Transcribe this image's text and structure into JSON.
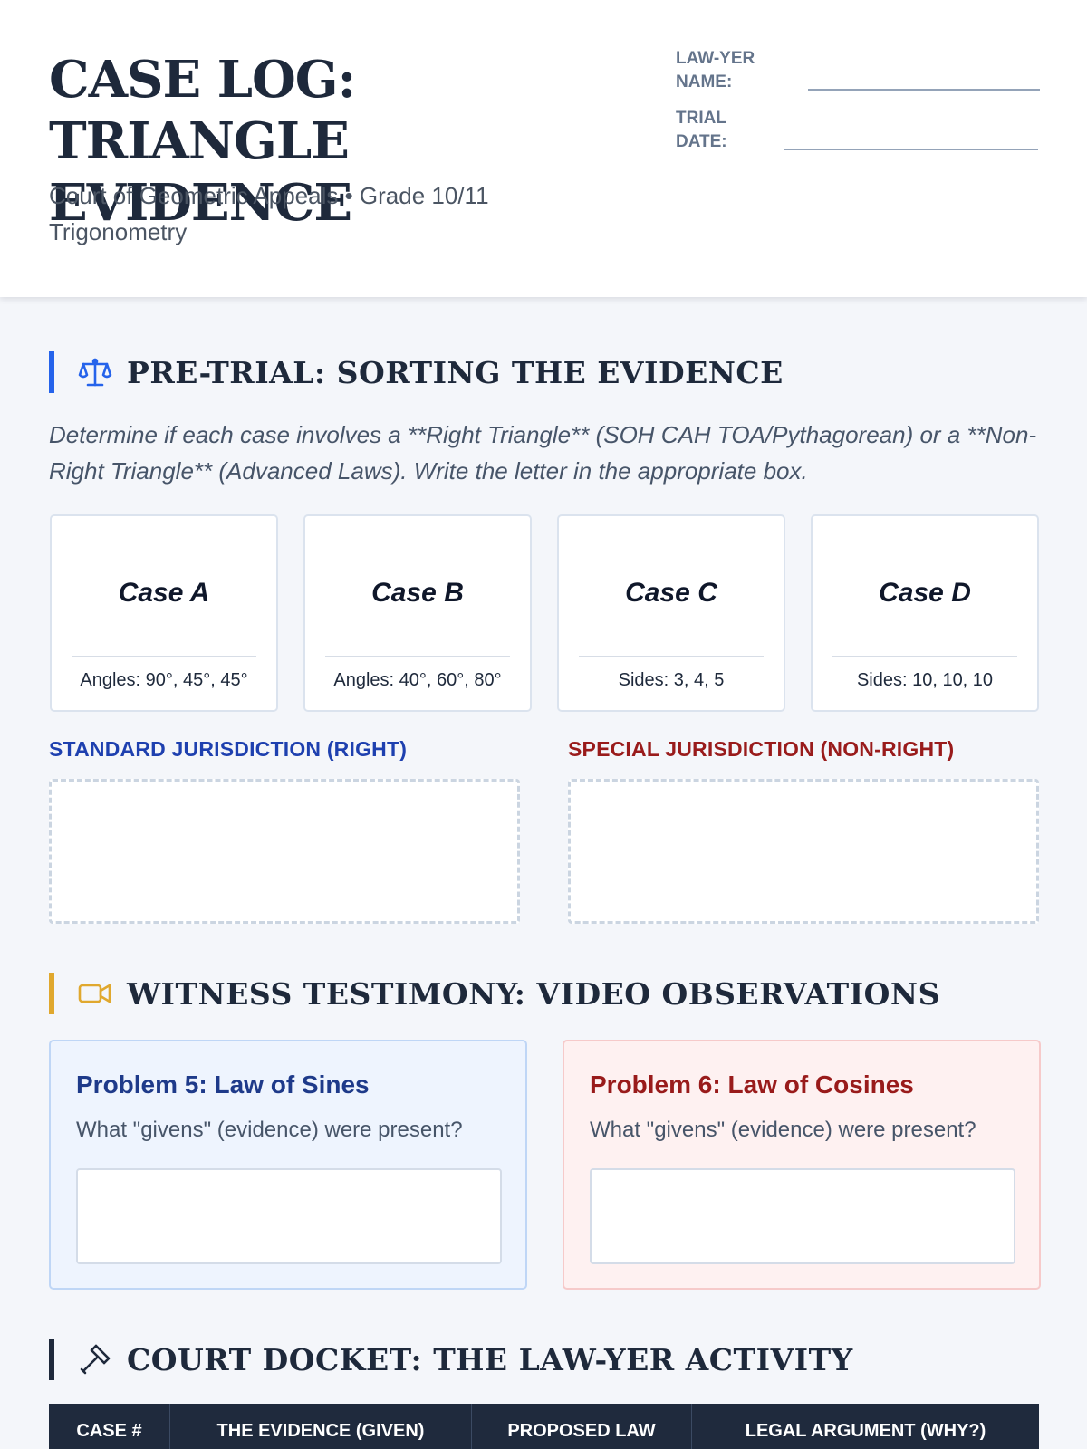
{
  "header": {
    "title": "CASE LOG: TRIANGLE EVIDENCE",
    "subtitle": "Court of Geometric Appeals • Grade 10/11 Trigonometry",
    "name_label": "LAW-YER NAME:",
    "date_label": "TRIAL DATE:"
  },
  "pretrial": {
    "icon": "scales-icon",
    "title": "PRE-TRIAL: SORTING THE EVIDENCE",
    "instructions": "Determine if each case involves a **Right Triangle** (SOH CAH TOA/Pythagorean) or a **Non-Right Triangle** (Advanced Laws). Write the letter in the appropriate box.",
    "cases": [
      {
        "name": "Case A",
        "info": "Angles: 90°, 45°, 45°"
      },
      {
        "name": "Case B",
        "info": "Angles: 40°, 60°, 80°"
      },
      {
        "name": "Case C",
        "info": "Sides: 3, 4, 5"
      },
      {
        "name": "Case D",
        "info": "Sides: 10, 10, 10"
      }
    ],
    "standard_label": "STANDARD JURISDICTION (RIGHT)",
    "special_label": "SPECIAL JURISDICTION (NON-RIGHT)"
  },
  "witness": {
    "icon": "video-camera-icon",
    "title": "WITNESS TESTIMONY: VIDEO OBSERVATIONS",
    "problems": [
      {
        "title": "Problem 5: Law of Sines",
        "question": "What \"givens\" (evidence) were present?"
      },
      {
        "title": "Problem 6: Law of Cosines",
        "question": "What \"givens\" (evidence) were present?"
      }
    ]
  },
  "docket": {
    "icon": "gavel-icon",
    "title": "COURT DOCKET: THE LAW-YER ACTIVITY",
    "columns": [
      "CASE #",
      "THE EVIDENCE (GIVEN)",
      "PROPOSED LAW",
      "LEGAL ARGUMENT (WHY?)"
    ]
  },
  "colors": {
    "navy": "#1e293b",
    "blue_accent": "#2563eb",
    "gold_accent": "#e0a82e",
    "standard_blue": "#1e40af",
    "special_red": "#991b1b",
    "blue_card_bg": "#eef4fe",
    "red_card_bg": "#fef1f1"
  }
}
